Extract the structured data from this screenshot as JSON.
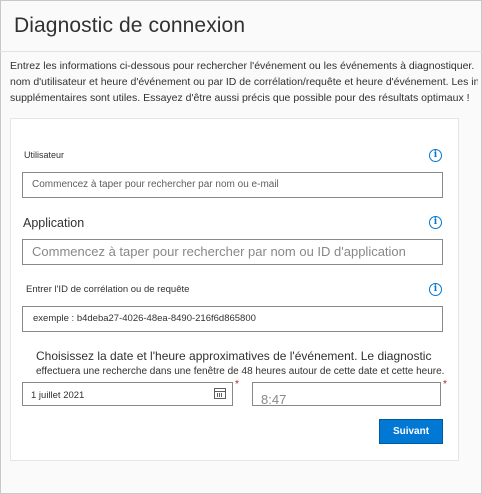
{
  "page": {
    "title": "Diagnostic de connexion",
    "intro_lines": [
      "Entrez les informations ci-dessous pour rechercher l'événement ou les événements à diagnostiquer. Recherchez par",
      "nom d'utilisateur et heure d'événement ou par ID de corrélation/requête et heure d'événement. Les informations",
      "supplémentaires sont utiles. Essayez d'être aussi précis que possible pour des résultats optimaux !"
    ]
  },
  "form": {
    "user": {
      "label": "Utilisateur",
      "placeholder": "Commencez à taper pour rechercher par nom ou e-mail",
      "info_icon": "info-icon"
    },
    "application": {
      "label": "Application",
      "placeholder": "Commencez à taper pour rechercher par nom ou ID d'application",
      "info_icon": "info-icon"
    },
    "correlation": {
      "label": "Entrer l'ID de corrélation ou de requête",
      "placeholder": "exemple : b4deba27-4026-48ea-8490-216f6d865800",
      "info_icon": "info-icon"
    },
    "datetime_help": {
      "line1": "Choisissez la date et l'heure approximatives de l'événement. Le diagnostic",
      "line2": "effectuera une recherche dans une fenêtre de 48 heures autour de cette date et cette heure."
    },
    "date": {
      "value": "1 juillet 2021",
      "icon": "calendar-icon",
      "required_mark": "*"
    },
    "time": {
      "value": "8:47",
      "required_mark": "*"
    },
    "next_button": "Suivant"
  },
  "colors": {
    "accent": "#0078d4",
    "required": "#a4262c",
    "border": "#8a8886"
  }
}
